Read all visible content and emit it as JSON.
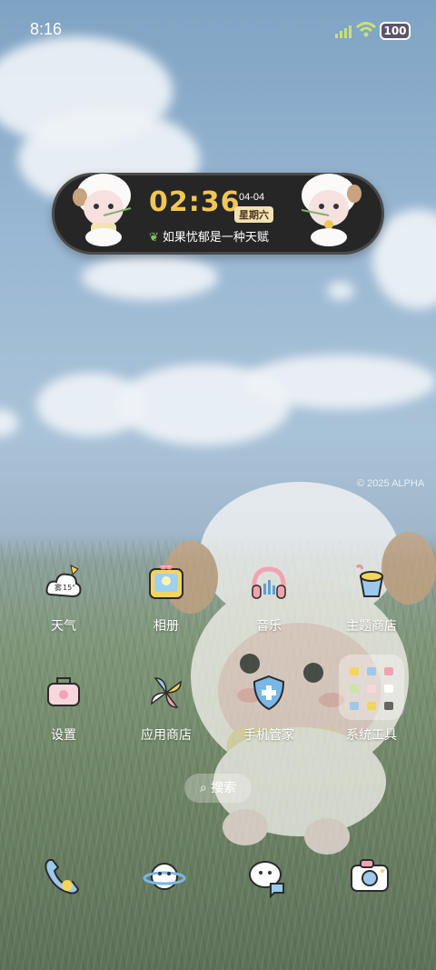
{
  "status_bar": {
    "time": "8:16",
    "battery": "100"
  },
  "widget": {
    "time": "02:36",
    "date": "04-04",
    "weekday": "星期六",
    "quote": "如果忧郁是一种天赋"
  },
  "watermark": "© 2025 ALPHA",
  "weather_badge": {
    "label": "雾",
    "temp": "15°"
  },
  "apps": [
    {
      "label": "天气",
      "icon": "cloud-weather-icon"
    },
    {
      "label": "相册",
      "icon": "photo-frame-icon"
    },
    {
      "label": "音乐",
      "icon": "headphones-icon"
    },
    {
      "label": "主题商店",
      "icon": "cup-icon"
    },
    {
      "label": "设置",
      "icon": "toolbox-icon"
    },
    {
      "label": "应用商店",
      "icon": "pinwheel-icon"
    },
    {
      "label": "手机管家",
      "icon": "shield-icon"
    },
    {
      "label": "系统工具",
      "icon": "folder-icon"
    }
  ],
  "search": {
    "label": "搜索"
  },
  "dock": [
    {
      "icon": "phone-icon"
    },
    {
      "icon": "planet-browser-icon"
    },
    {
      "icon": "chat-bubble-icon"
    },
    {
      "icon": "camera-icon"
    }
  ],
  "colors": {
    "clock": "#f0c655",
    "widget_bg": "#262626"
  }
}
